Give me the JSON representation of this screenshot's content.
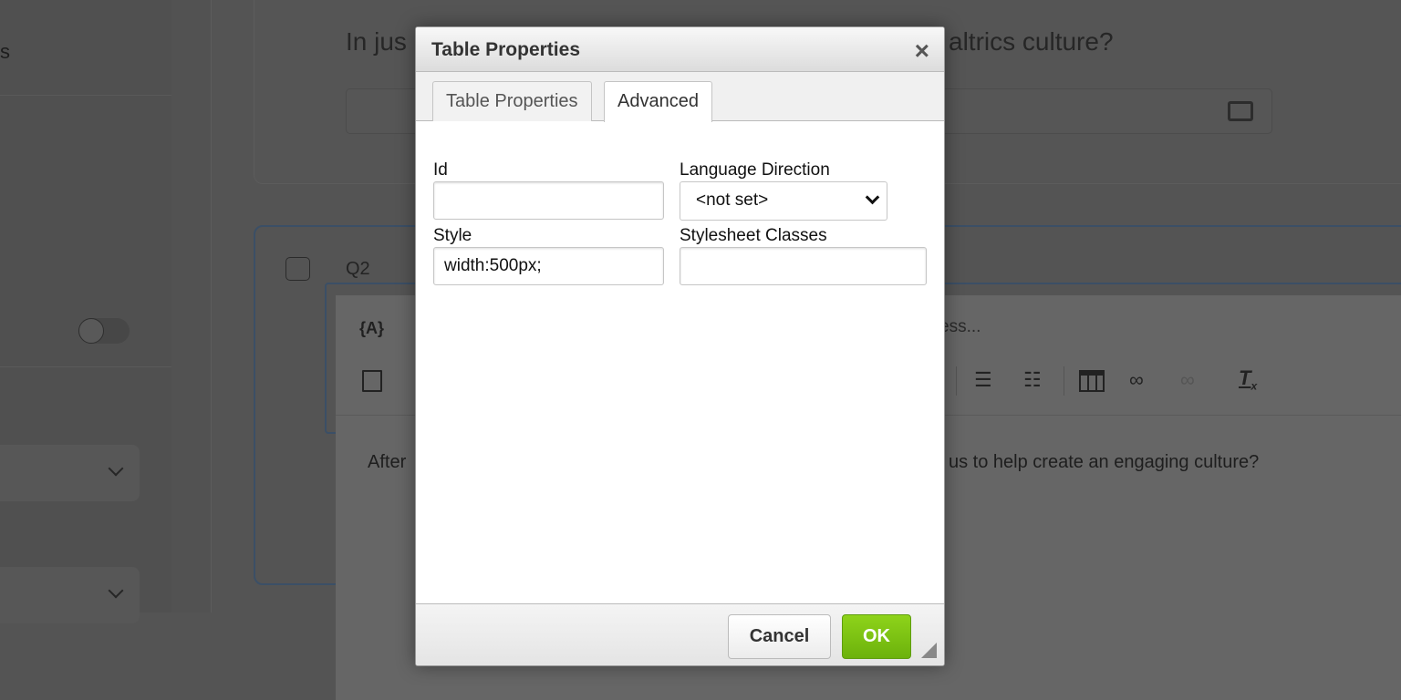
{
  "background": {
    "sidebar_text": "s",
    "question1_start": "In jus",
    "question1_end": "altrics culture?",
    "question2_label": "Q2",
    "editor_placeholder_end": "ess...",
    "editor_piped_text_icon": "{A}",
    "editor_text_start": "After",
    "editor_text_end": "us to help create an engaging culture?"
  },
  "dialog": {
    "title": "Table Properties",
    "close_icon": "×",
    "tabs": [
      {
        "label": "Table Properties",
        "active": false
      },
      {
        "label": "Advanced",
        "active": true
      }
    ],
    "fields": {
      "id_label": "Id",
      "id_value": "",
      "lang_label": "Language Direction",
      "lang_value": "<not set>",
      "style_label": "Style",
      "style_value": "width:500px;",
      "classes_label": "Stylesheet Classes",
      "classes_value": ""
    },
    "cancel_label": "Cancel",
    "ok_label": "OK"
  },
  "colors": {
    "ok_button": "#7bc314",
    "focus_border": "#3b4f66"
  }
}
